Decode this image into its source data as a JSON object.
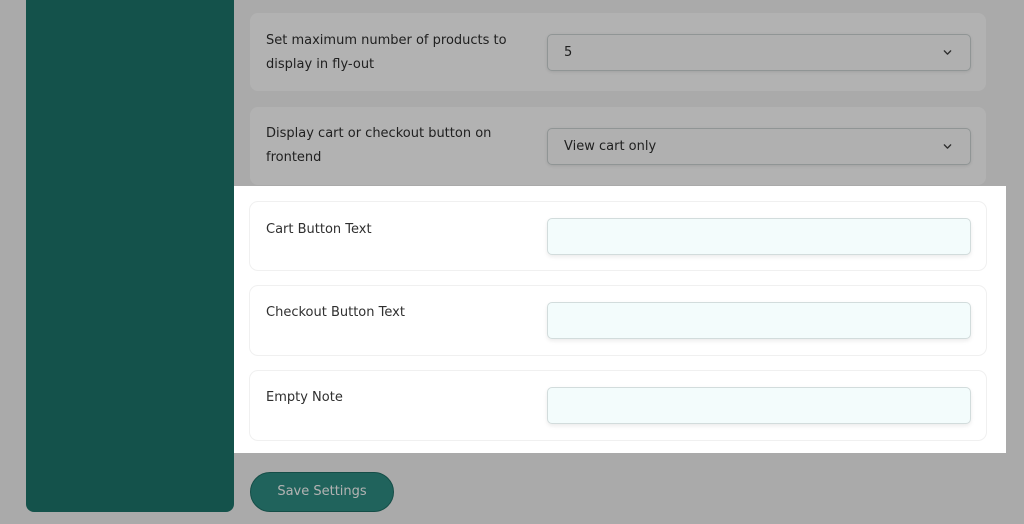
{
  "settings": {
    "max_products": {
      "label": "Set maximum number of products to display in fly-out",
      "value": "5"
    },
    "cart_checkout_display": {
      "label": "Display cart or checkout button on frontend",
      "value": "View cart only"
    },
    "cart_button_text": {
      "label": "Cart Button Text",
      "value": ""
    },
    "checkout_button_text": {
      "label": "Checkout Button Text",
      "value": ""
    },
    "empty_note": {
      "label": "Empty Note",
      "value": ""
    }
  },
  "actions": {
    "save_label": "Save Settings"
  },
  "colors": {
    "sidebar": "#1e766c",
    "primary_button": "#2e8f84"
  }
}
